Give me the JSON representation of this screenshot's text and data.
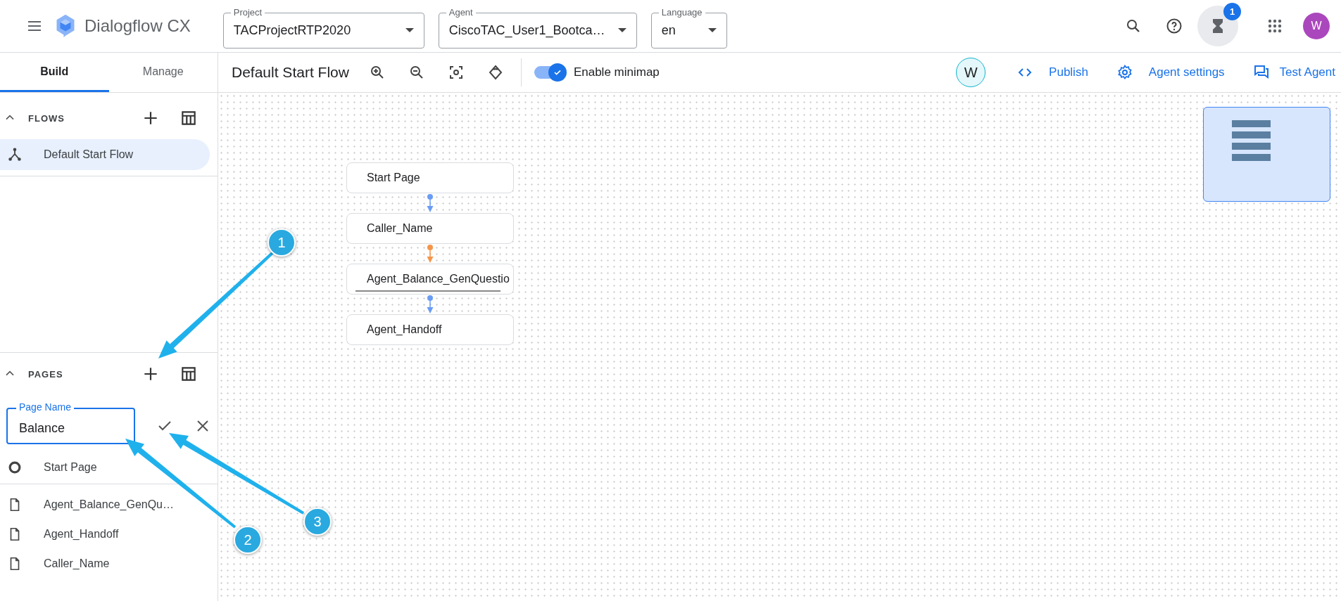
{
  "app": {
    "title": "Dialogflow CX"
  },
  "selectors": [
    {
      "label": "Project",
      "value": "TACProjectRTP2020"
    },
    {
      "label": "Agent",
      "value": "CiscoTAC_User1_Bootca…"
    },
    {
      "label": "Language",
      "value": "en"
    }
  ],
  "notifications": {
    "badge": "1"
  },
  "account": {
    "initial": "W"
  },
  "side_tabs": [
    {
      "label": "Build",
      "selected": true
    },
    {
      "label": "Manage",
      "selected": false
    }
  ],
  "flows": {
    "title": "FLOWS",
    "expanded": true,
    "items": [
      {
        "label": "Default Start Flow",
        "selected": true
      }
    ]
  },
  "pages": {
    "title": "PAGES",
    "expanded": true,
    "new_page": {
      "label": "Page Name",
      "value": "Balance"
    },
    "start_page": "Start Page",
    "items": [
      "Agent_Balance_GenQu…",
      "Agent_Handoff",
      "Caller_Name"
    ]
  },
  "toolbar": {
    "title": "Default Start Flow",
    "minimap": {
      "label": "Enable minimap",
      "on": true
    },
    "user_initial": "W",
    "actions": [
      {
        "kind": "code",
        "label": "Publish"
      },
      {
        "kind": "gear",
        "label": "Agent settings"
      },
      {
        "kind": "chat",
        "label": "Test Agent"
      }
    ]
  },
  "graph": {
    "nodes": [
      {
        "label": "Start Page",
        "underlined": false
      },
      {
        "label": "Caller_Name",
        "underlined": false
      },
      {
        "label": "Agent_Balance_GenQuestio",
        "underlined": true
      },
      {
        "label": "Agent_Handoff",
        "underlined": false
      }
    ],
    "edges": [
      {
        "color": "#6a9cf4"
      },
      {
        "color": "#f5954a"
      },
      {
        "color": "#6a9cf4"
      }
    ]
  },
  "callouts": [
    {
      "number": "1"
    },
    {
      "number": "2"
    },
    {
      "number": "3"
    }
  ]
}
